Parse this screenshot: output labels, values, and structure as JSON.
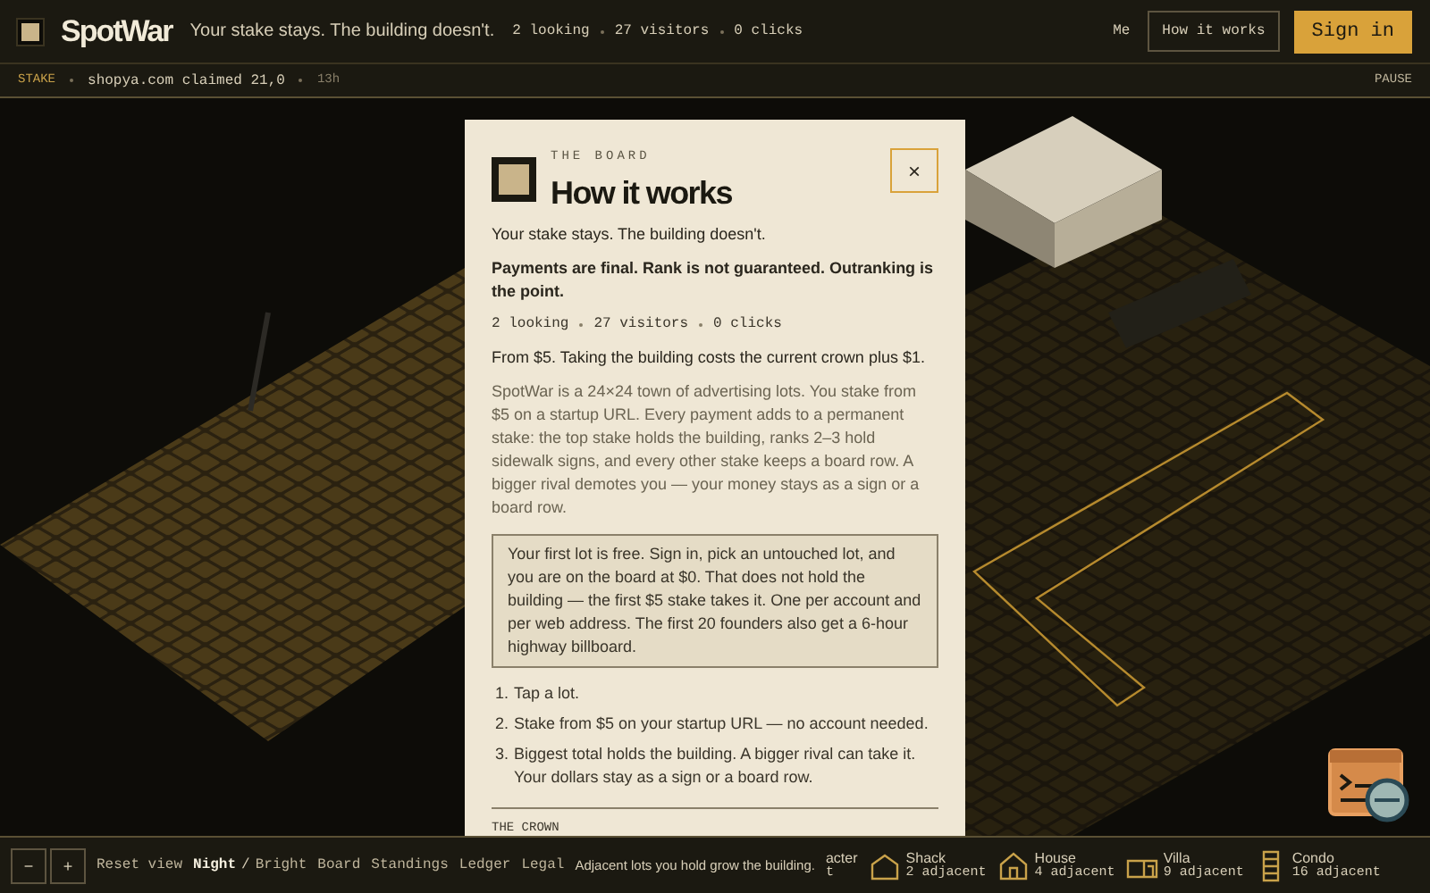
{
  "header": {
    "logo": "SpotWar",
    "tagline": "Your stake stays. The building doesn't.",
    "stats": [
      "2 looking",
      "27 visitors",
      "0 clicks"
    ],
    "links": [
      {
        "label": "Me",
        "kind": "plain"
      },
      {
        "label": "How it works",
        "kind": "outline"
      },
      {
        "label": "Sign in",
        "kind": "primary"
      }
    ]
  },
  "ticker": {
    "label": "STAKE",
    "message": "shopya.com claimed 21,0",
    "time": "13h",
    "action": "PAUSE"
  },
  "dialog": {
    "eyebrow": "THE BOARD",
    "title": "How it works",
    "close": "×",
    "lead": "Your stake stays. The building doesn't.",
    "notice": "Payments are final. Rank is not guaranteed. Outranking is the point.",
    "stats": [
      "2 looking",
      "27 visitors",
      "0 clicks"
    ],
    "pricing": "From $5. Taking the building costs the current crown plus $1.",
    "description": "SpotWar is a 24×24 town of advertising lots. You stake from $5 on a startup URL. Every payment adds to a permanent stake: the top stake holds the building, ranks 2–3 hold sidewalk signs, and every other stake keeps a board row. A bigger rival demotes you — your money stays as a sign or a board row.",
    "callout": "Your first lot is free. Sign in, pick an untouched lot, and you are on the board at $0. That does not hold the building — the first $5 stake takes it. One per account and per web address. The first 20 founders also get a 6-hour highway billboard.",
    "steps": [
      {
        "number": "1.",
        "text": "Tap a lot."
      },
      {
        "number": "2.",
        "text": "Stake from $5 on your startup URL — no account needed."
      },
      {
        "number": "3.",
        "text": "Biggest total holds the building. A bigger rival can take it. Your dollars stay as a sign or a board row."
      }
    ],
    "next_section": "THE CROWN"
  },
  "footer": {
    "zoom": [
      "−",
      "+"
    ],
    "reset": "Reset view",
    "theme": {
      "options": [
        {
          "label": "Night",
          "selected": true
        },
        {
          "label": "Bright",
          "selected": false
        }
      ],
      "separator": "/"
    },
    "links": [
      "Board",
      "Standings",
      "Ledger",
      "Legal"
    ],
    "hint": "Adjacent lots you hold grow the building.",
    "legend": [
      {
        "kind": "partial",
        "name": "acter",
        "count": "t"
      },
      {
        "kind": "shack",
        "name": "Shack",
        "count": "2 adjacent"
      },
      {
        "kind": "house",
        "name": "House",
        "count": "4 adjacent"
      },
      {
        "kind": "villa",
        "name": "Villa",
        "count": "9 adjacent"
      },
      {
        "kind": "condo",
        "name": "Condo",
        "count": "16 adjacent"
      }
    ]
  }
}
